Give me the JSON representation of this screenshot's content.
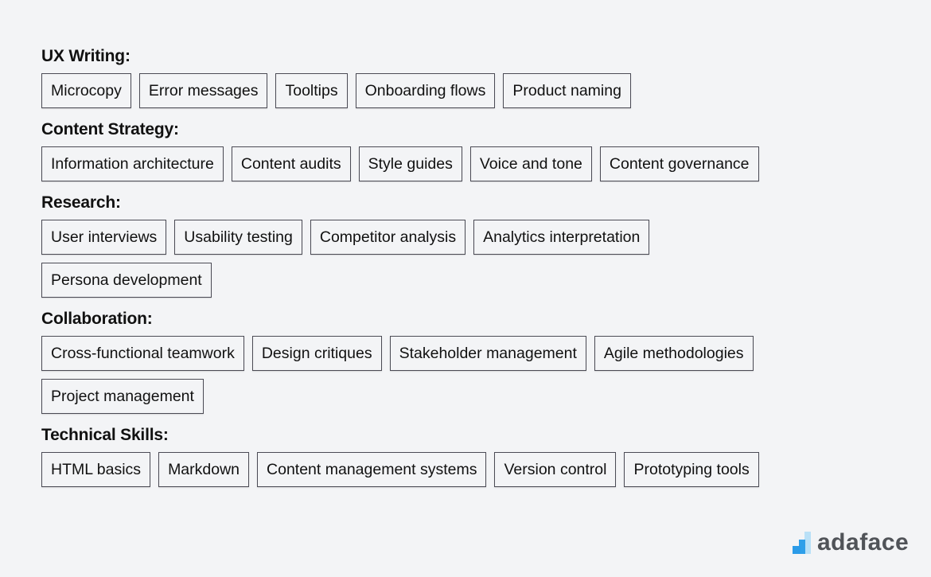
{
  "sections": [
    {
      "title": "UX Writing:",
      "skills": [
        "Microcopy",
        "Error messages",
        "Tooltips",
        "Onboarding flows",
        "Product naming"
      ]
    },
    {
      "title": "Content Strategy:",
      "skills": [
        "Information architecture",
        "Content audits",
        "Style guides",
        "Voice and tone",
        "Content governance"
      ]
    },
    {
      "title": "Research:",
      "skills": [
        "User interviews",
        "Usability testing",
        "Competitor analysis",
        "Analytics interpretation",
        "Persona development"
      ]
    },
    {
      "title": "Collaboration:",
      "skills": [
        "Cross-functional teamwork",
        "Design critiques",
        "Stakeholder management",
        "Agile methodologies",
        "Project management"
      ]
    },
    {
      "title": "Technical Skills:",
      "skills": [
        "HTML basics",
        "Markdown",
        "Content management systems",
        "Version control",
        "Prototyping tools"
      ]
    }
  ],
  "brand": {
    "name": "adaface",
    "icon": "bar-chart-logo-icon",
    "colors": {
      "primary": "#2b9be8",
      "light": "#b9e0f7",
      "text": "#505358"
    }
  },
  "colors": {
    "background": "#f3f4f6",
    "chip_border": "#4b4b55",
    "text": "#111111"
  }
}
